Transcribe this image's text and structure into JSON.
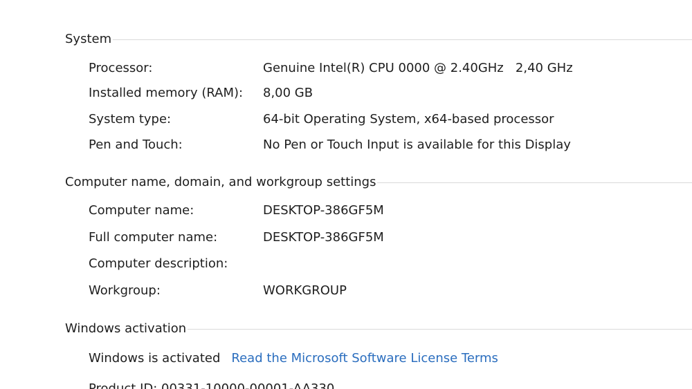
{
  "system": {
    "title": "System",
    "rows": [
      {
        "label": "Processor:",
        "value": "Genuine Intel(R) CPU 0000 @ 2.40GHz   2,40 GHz"
      },
      {
        "label": "Installed memory (RAM):",
        "value": "8,00 GB"
      },
      {
        "label": "System type:",
        "value": "64-bit Operating System, x64-based processor"
      },
      {
        "label": "Pen and Touch:",
        "value": "No Pen or Touch Input is available for this Display"
      }
    ]
  },
  "computer_name": {
    "title": "Computer name, domain, and workgroup settings",
    "rows": [
      {
        "label": "Computer name:",
        "value": "DESKTOP-386GF5M"
      },
      {
        "label": "Full computer name:",
        "value": "DESKTOP-386GF5M"
      },
      {
        "label": "Computer description:",
        "value": ""
      },
      {
        "label": "Workgroup:",
        "value": "WORKGROUP"
      }
    ]
  },
  "activation": {
    "title": "Windows activation",
    "status": "Windows is activated",
    "license_link": "Read the Microsoft Software License Terms",
    "product_id_partial": "Product ID: 00331-10000-00001-AA330"
  }
}
